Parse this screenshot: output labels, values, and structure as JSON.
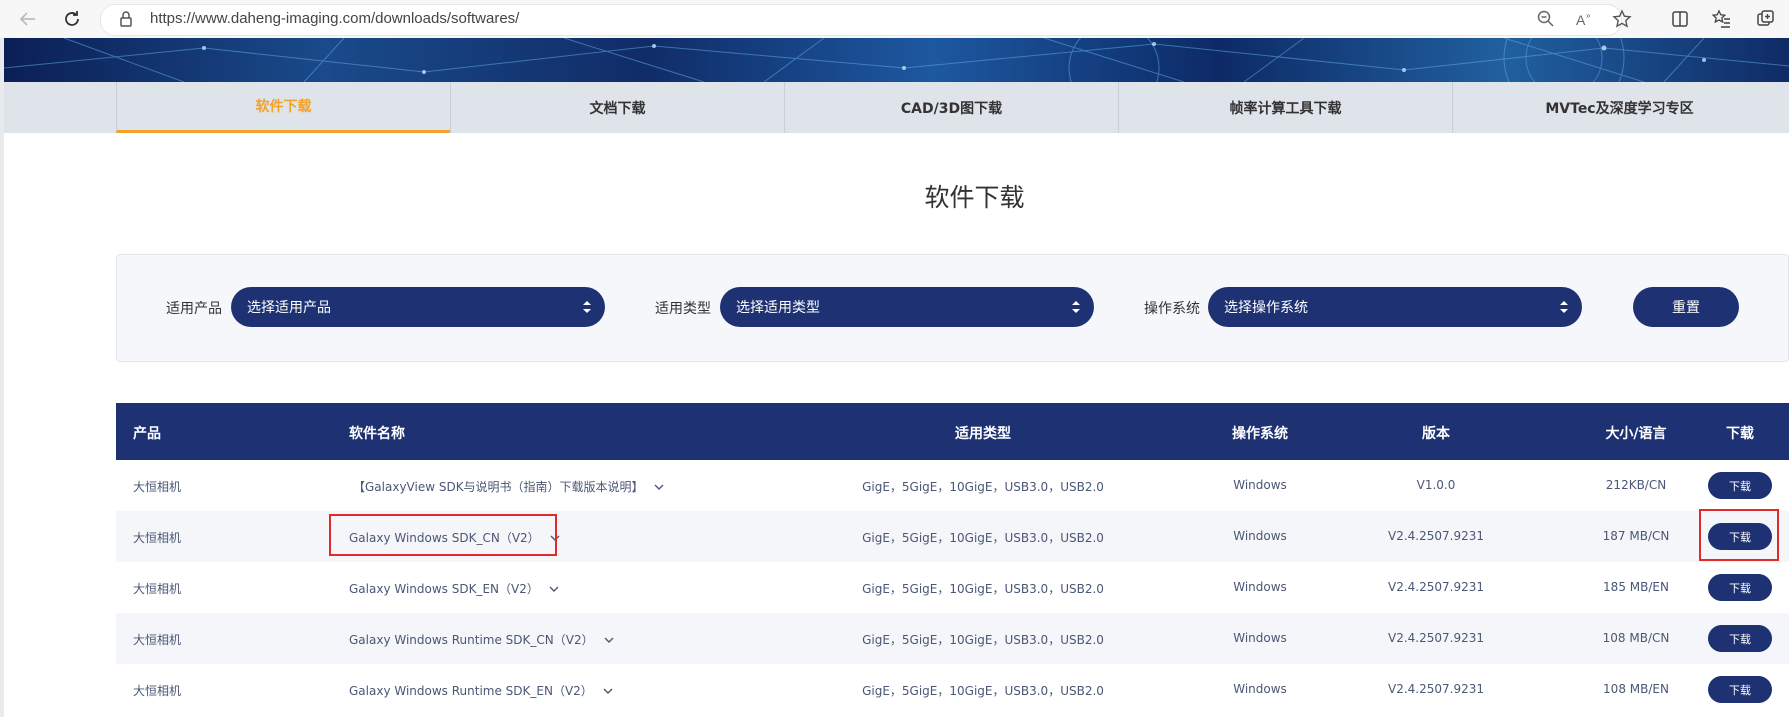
{
  "browser": {
    "url": "https://www.daheng-imaging.com/downloads/softwares/"
  },
  "tabs": [
    {
      "label": "软件下载",
      "active": true
    },
    {
      "label": "文档下载",
      "active": false
    },
    {
      "label": "CAD/3D图下载",
      "active": false
    },
    {
      "label": "帧率计算工具下载",
      "active": false
    },
    {
      "label": "MVTec及深度学习专区",
      "active": false
    }
  ],
  "page_title": "软件下载",
  "filters": {
    "product_label": "适用产品",
    "product_placeholder": "选择适用产品",
    "type_label": "适用类型",
    "type_placeholder": "选择适用类型",
    "os_label": "操作系统",
    "os_placeholder": "选择操作系统",
    "reset_label": "重置"
  },
  "table": {
    "headers": [
      "产品",
      "软件名称",
      "适用类型",
      "操作系统",
      "版本",
      "大小/语言",
      "下载"
    ],
    "rows": [
      {
        "product": "大恒相机",
        "name": "【GalaxyView SDK与说明书（指南）下载版本说明】",
        "types": "GigE，5GigE，10GigE，USB3.0，USB2.0",
        "os": "Windows",
        "version": "V1.0.0",
        "size": "212KB/CN",
        "download": "下载"
      },
      {
        "product": "大恒相机",
        "name": "Galaxy Windows SDK_CN（V2）",
        "types": "GigE，5GigE，10GigE，USB3.0，USB2.0",
        "os": "Windows",
        "version": "V2.4.2507.9231",
        "size": "187 MB/CN",
        "download": "下载"
      },
      {
        "product": "大恒相机",
        "name": "Galaxy Windows SDK_EN（V2）",
        "types": "GigE，5GigE，10GigE，USB3.0，USB2.0",
        "os": "Windows",
        "version": "V2.4.2507.9231",
        "size": "185 MB/EN",
        "download": "下载"
      },
      {
        "product": "大恒相机",
        "name": "Galaxy Windows Runtime SDK_CN（V2）",
        "types": "GigE，5GigE，10GigE，USB3.0，USB2.0",
        "os": "Windows",
        "version": "V2.4.2507.9231",
        "size": "108 MB/CN",
        "download": "下载"
      },
      {
        "product": "大恒相机",
        "name": "Galaxy Windows Runtime SDK_EN（V2）",
        "types": "GigE，5GigE，10GigE，USB3.0，USB2.0",
        "os": "Windows",
        "version": "V2.4.2507.9231",
        "size": "108 MB/EN",
        "download": "下载"
      }
    ]
  },
  "colors": {
    "navy": "#1d3173",
    "accent": "#f0a22a",
    "highlight": "#e12a2a"
  }
}
